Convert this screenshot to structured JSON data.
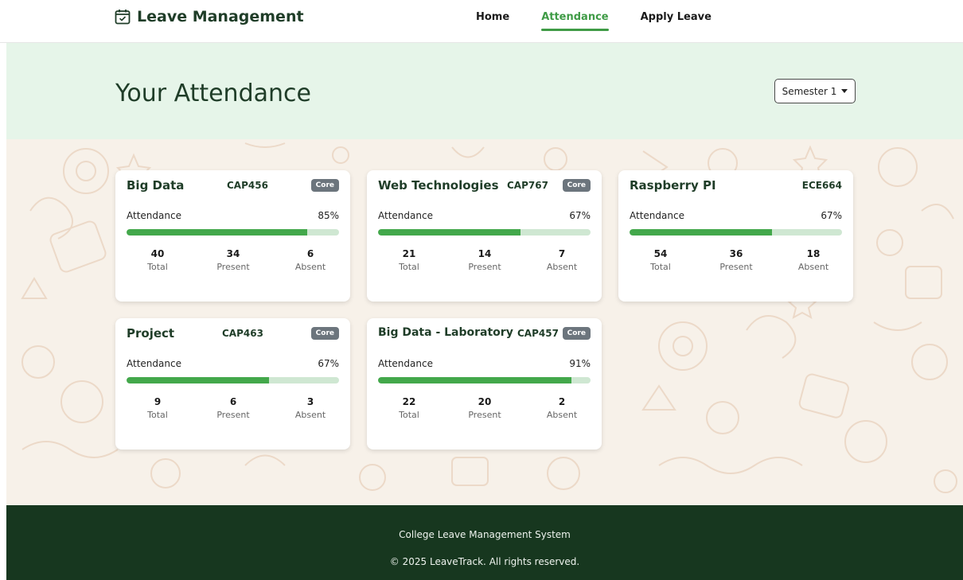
{
  "nav": {
    "brand": "Leave Management",
    "links": [
      {
        "label": "Home",
        "active": false
      },
      {
        "label": "Attendance",
        "active": true
      },
      {
        "label": "Apply Leave",
        "active": false
      }
    ]
  },
  "hero": {
    "title": "Your Attendance",
    "semester": "Semester 1"
  },
  "cards": [
    {
      "name": "Big Data",
      "code": "CAP456",
      "badge": "Core",
      "attendance_label": "Attendance",
      "percent": "85%",
      "fill": 0.85,
      "total": "40",
      "present": "34",
      "absent": "6"
    },
    {
      "name": "Web Technologies",
      "code": "CAP767",
      "badge": "Core",
      "attendance_label": "Attendance",
      "percent": "67%",
      "fill": 0.67,
      "total": "21",
      "present": "14",
      "absent": "7"
    },
    {
      "name": "Raspberry PI",
      "code": "ECE664",
      "badge": "",
      "attendance_label": "Attendance",
      "percent": "67%",
      "fill": 0.67,
      "total": "54",
      "present": "36",
      "absent": "18"
    },
    {
      "name": "Project",
      "code": "CAP463",
      "badge": "Core",
      "attendance_label": "Attendance",
      "percent": "67%",
      "fill": 0.67,
      "total": "9",
      "present": "6",
      "absent": "3"
    },
    {
      "name": "Big Data - Laboratory",
      "code": "CAP457",
      "badge": "Core",
      "attendance_label": "Attendance",
      "percent": "91%",
      "fill": 0.91,
      "total": "22",
      "present": "20",
      "absent": "2"
    }
  ],
  "stat_labels": {
    "total": "Total",
    "present": "Present",
    "absent": "Absent"
  },
  "footer": {
    "line1": "College Leave Management System",
    "line2": "© 2025 LeaveTrack. All rights reserved."
  },
  "colors": {
    "accent": "#3f9b46",
    "dark": "#17371f",
    "hero_bg": "#e6f5e9",
    "badge": "#6c757d"
  }
}
